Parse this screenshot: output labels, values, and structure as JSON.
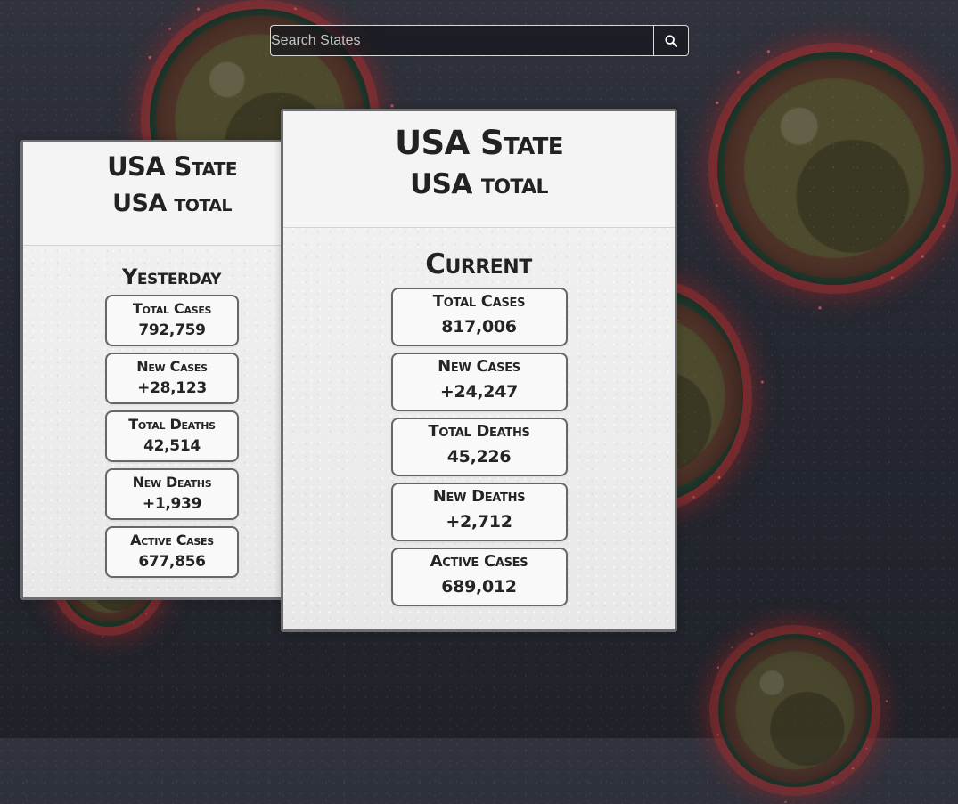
{
  "search": {
    "placeholder": "Search States",
    "button_icon": "search-icon"
  },
  "cards": {
    "yesterday": {
      "title": "USA State",
      "subtitle": "USA total",
      "section": "Yesterday",
      "stats": [
        {
          "label": "Total Cases",
          "value": "792,759"
        },
        {
          "label": "New Cases",
          "value": "+28,123"
        },
        {
          "label": "Total Deaths",
          "value": "42,514"
        },
        {
          "label": "New Deaths",
          "value": "+1,939"
        },
        {
          "label": "Active Cases",
          "value": "677,856"
        }
      ]
    },
    "current": {
      "title": "USA State",
      "subtitle": "USA total",
      "section": "Current",
      "stats": [
        {
          "label": "Total Cases",
          "value": "817,006"
        },
        {
          "label": "New Cases",
          "value": "+24,247"
        },
        {
          "label": "Total Deaths",
          "value": "45,226"
        },
        {
          "label": "New Deaths",
          "value": "+2,712"
        },
        {
          "label": "Active Cases",
          "value": "689,012"
        }
      ]
    }
  },
  "colors": {
    "background": "#262932",
    "card_background": "#eeeeee",
    "card_border": "#6d6d70",
    "text_dark": "#222222",
    "search_border": "#d8d8d8"
  }
}
